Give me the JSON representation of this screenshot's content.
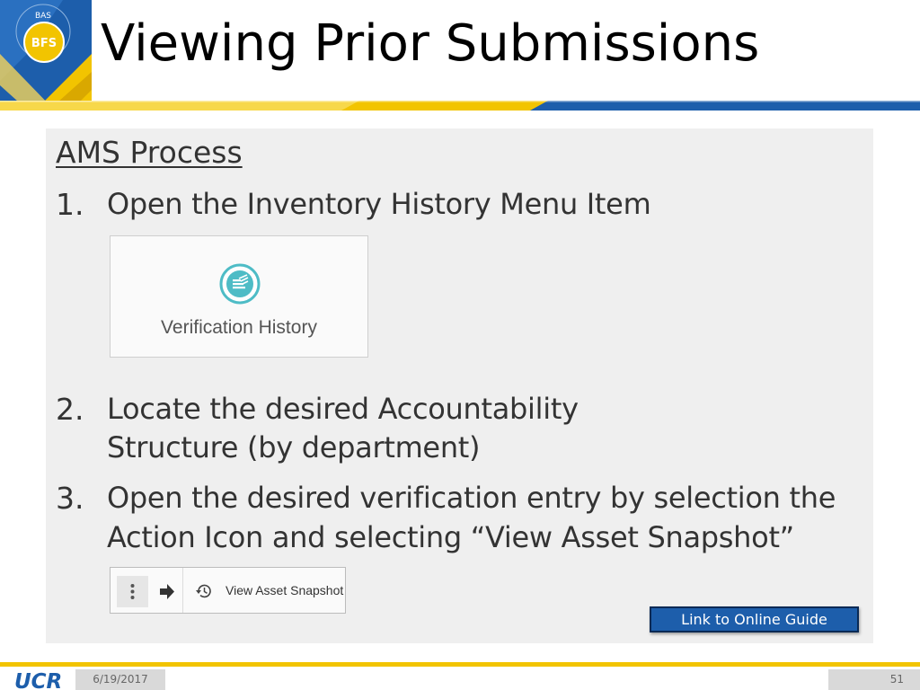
{
  "header": {
    "title": "Viewing Prior Submissions",
    "badge_top": "BAS",
    "badge_main": "BFS"
  },
  "content": {
    "heading": "AMS Process",
    "steps": [
      {
        "number": "1.",
        "lines": [
          "Open the Inventory History Menu Item"
        ]
      },
      {
        "number": "2.",
        "lines": [
          "Locate the desired Accountability",
          "Structure (by department)"
        ]
      },
      {
        "number": "3.",
        "lines": [
          "Open the desired verification entry by selection the",
          "Action Icon and selecting “View Asset Snapshot”"
        ]
      }
    ],
    "verification_card": {
      "label": "Verification History",
      "icon": "stacked-list-icon"
    },
    "snapshot_bar": {
      "label": "View Asset Snapshot",
      "icons": [
        "more-vertical-icon",
        "arrow-right-icon",
        "history-icon"
      ]
    },
    "link_button": "Link to Online Guide"
  },
  "footer": {
    "logo": "UCR",
    "date": "6/19/2017",
    "page": "51"
  },
  "colors": {
    "brand_blue": "#1d5eab",
    "brand_gold": "#f2c400",
    "teal_accent": "#4ebcc6",
    "panel_bg": "#efefef"
  }
}
